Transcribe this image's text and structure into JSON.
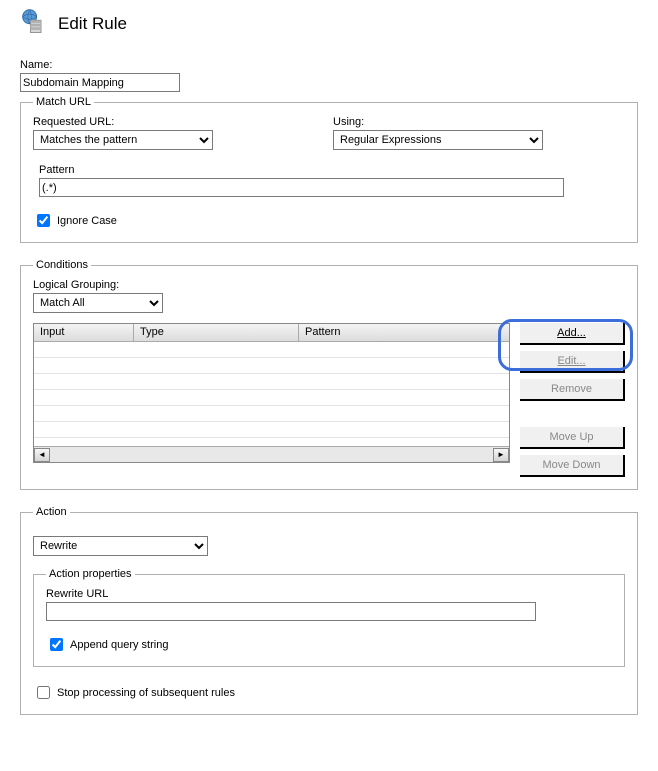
{
  "header": {
    "title": "Edit Rule"
  },
  "name": {
    "label": "Name:",
    "value": "Subdomain Mapping"
  },
  "matchUrl": {
    "legend": "Match URL",
    "requestedUrl": {
      "label": "Requested URL:",
      "value": "Matches the pattern"
    },
    "using": {
      "label": "Using:",
      "value": "Regular Expressions"
    },
    "pattern": {
      "label": "Pattern",
      "value": "(.*)"
    },
    "ignoreCase": {
      "label": "Ignore Case",
      "checked": true
    }
  },
  "conditions": {
    "legend": "Conditions",
    "grouping": {
      "label": "Logical Grouping:",
      "value": "Match All"
    },
    "columns": {
      "input": "Input",
      "type": "Type",
      "pattern": "Pattern"
    },
    "buttons": {
      "add": "Add...",
      "edit": "Edit...",
      "remove": "Remove",
      "moveUp": "Move Up",
      "moveDown": "Move Down"
    }
  },
  "action": {
    "legend": "Action",
    "type": {
      "value": "Rewrite"
    },
    "props": {
      "legend": "Action properties",
      "rewriteUrl": {
        "label": "Rewrite URL",
        "value": ""
      },
      "appendQuery": {
        "label": "Append query string",
        "checked": true
      }
    },
    "stopProcessing": {
      "label": "Stop processing of subsequent rules",
      "checked": false
    }
  }
}
